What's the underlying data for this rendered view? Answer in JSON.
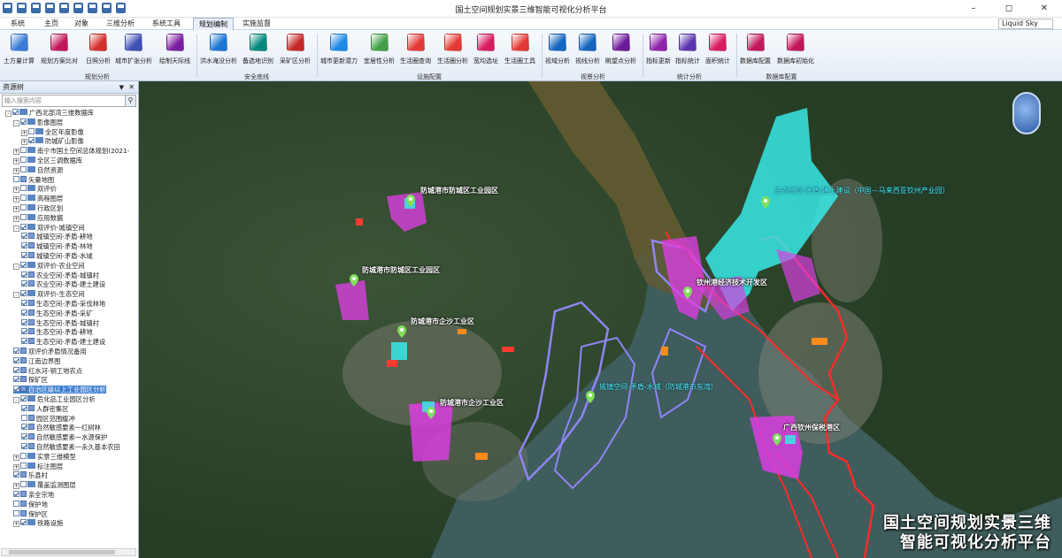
{
  "window": {
    "title": "国土空间规划实景三维智能可视化分析平台",
    "controls": [
      "–",
      "◻",
      "✕"
    ]
  },
  "tabs": [
    {
      "label": "系统"
    },
    {
      "label": "主页"
    },
    {
      "label": "对象"
    },
    {
      "label": "三维分析"
    },
    {
      "label": "系统工具"
    },
    {
      "label": "规划编制",
      "active": true
    },
    {
      "label": "实施监督"
    }
  ],
  "skin": {
    "value": "Liquid Sky"
  },
  "ribbon": {
    "buttons": [
      {
        "label": "土方量计算",
        "color": "#3a7bd5"
      },
      {
        "label": "规划方案比对",
        "color": "#c2185b"
      },
      {
        "label": "日照分析",
        "color": "#d32f2f"
      },
      {
        "label": "城市扩张分析",
        "color": "#3f51b5"
      },
      {
        "label": "绘制天际线",
        "color": "#7b1fa2"
      },
      {
        "label": "洪水淹没分析",
        "color": "#1976d2"
      },
      {
        "label": "备选地识别",
        "color": "#00897b"
      },
      {
        "label": "采矿区分析",
        "color": "#c62828"
      },
      {
        "label": "城市更新潜力",
        "color": "#1e88e5"
      },
      {
        "label": "宜居性分析",
        "color": "#43a047"
      },
      {
        "label": "生活圈查询",
        "color": "#e53935"
      },
      {
        "label": "生活圈分析",
        "color": "#e53935"
      },
      {
        "label": "宽均选址",
        "color": "#d81b60"
      },
      {
        "label": "生活圈工具",
        "color": "#e53935"
      },
      {
        "label": "视域分析",
        "color": "#1565c0"
      },
      {
        "label": "视线分析",
        "color": "#1565c0"
      },
      {
        "label": "眺望点分析",
        "color": "#6a1b9a"
      },
      {
        "label": "指标更新",
        "color": "#8e24aa"
      },
      {
        "label": "指标统计",
        "color": "#5e35b1"
      },
      {
        "label": "面积统计",
        "color": "#d81b60"
      },
      {
        "label": "数据库配置",
        "color": "#c2185b"
      },
      {
        "label": "数据库初始化",
        "color": "#c2185b"
      }
    ],
    "groups": [
      {
        "label": "规划分析"
      },
      {
        "label": "安全底线"
      },
      {
        "label": "设施配置"
      },
      {
        "label": "视景分析"
      },
      {
        "label": "统计分析"
      },
      {
        "label": "数据库配置"
      }
    ]
  },
  "left_panel": {
    "title": "资源树",
    "search_placeholder": "输入搜索内容",
    "tree": [
      {
        "label": "广西北部湾三维数据库",
        "level": 0,
        "type": "folder",
        "checked": true,
        "exp": "-"
      },
      {
        "label": "影像图层",
        "level": 1,
        "type": "folder",
        "checked": true,
        "exp": "-"
      },
      {
        "label": "全区年度影像",
        "level": 2,
        "type": "folder",
        "checked": false,
        "exp": "+"
      },
      {
        "label": "防城矿山影像",
        "level": 2,
        "type": "folder",
        "checked": true,
        "exp": "+"
      },
      {
        "label": "南宁市国土空间总体规划(2021-",
        "level": 1,
        "type": "folder",
        "checked": false,
        "exp": "+"
      },
      {
        "label": "全区三调数据库",
        "level": 1,
        "type": "folder",
        "checked": false,
        "exp": "+"
      },
      {
        "label": "自然资源",
        "level": 1,
        "type": "folder",
        "checked": false,
        "exp": "+"
      },
      {
        "label": "矢量地图",
        "level": 1,
        "type": "layer",
        "checked": false,
        "exp": ""
      },
      {
        "label": "双评价",
        "level": 1,
        "type": "folder",
        "checked": false,
        "exp": "+"
      },
      {
        "label": "高程图层",
        "level": 1,
        "type": "folder",
        "checked": false,
        "exp": "+"
      },
      {
        "label": "行政区划",
        "level": 1,
        "type": "folder",
        "checked": false,
        "exp": "+"
      },
      {
        "label": "应用数据",
        "level": 1,
        "type": "folder",
        "checked": false,
        "exp": "+"
      },
      {
        "label": "双评价-城镇空间",
        "level": 1,
        "type": "folder",
        "checked": true,
        "exp": "-"
      },
      {
        "label": "城镇空间-矛盾-耕地",
        "level": 2,
        "type": "layer",
        "checked": true,
        "exp": ""
      },
      {
        "label": "城镇空间-矛盾-林地",
        "level": 2,
        "type": "layer",
        "checked": true,
        "exp": ""
      },
      {
        "label": "城镇空间-矛盾-水域",
        "level": 2,
        "type": "layer",
        "checked": true,
        "exp": ""
      },
      {
        "label": "双评价-农业空间",
        "level": 1,
        "type": "folder",
        "checked": true,
        "exp": "-"
      },
      {
        "label": "农业空间-矛盾-城镇村",
        "level": 2,
        "type": "layer",
        "checked": true,
        "exp": ""
      },
      {
        "label": "农业空间-矛盾-建土建设",
        "level": 2,
        "type": "layer",
        "checked": true,
        "exp": ""
      },
      {
        "label": "双评价-生态空间",
        "level": 1,
        "type": "folder",
        "checked": true,
        "exp": "-"
      },
      {
        "label": "生态空间-矛盾-采伐林地",
        "level": 2,
        "type": "layer",
        "checked": true,
        "exp": ""
      },
      {
        "label": "生态空间-矛盾-采矿",
        "level": 2,
        "type": "layer",
        "checked": true,
        "exp": ""
      },
      {
        "label": "生态空间-矛盾-城镇村",
        "level": 2,
        "type": "layer",
        "checked": true,
        "exp": ""
      },
      {
        "label": "生态空间-矛盾-耕地",
        "level": 2,
        "type": "layer",
        "checked": true,
        "exp": ""
      },
      {
        "label": "生态空间-矛盾-建土建设",
        "level": 2,
        "type": "layer",
        "checked": true,
        "exp": ""
      },
      {
        "label": "双评价矛盾情况备用",
        "level": 1,
        "type": "layer",
        "checked": true,
        "exp": ""
      },
      {
        "label": "江南边界图",
        "level": 1,
        "type": "layer",
        "checked": true,
        "exp": ""
      },
      {
        "label": "红水河-铜工地农点",
        "level": 1,
        "type": "layer",
        "checked": true,
        "exp": ""
      },
      {
        "label": "探矿区",
        "level": 1,
        "type": "layer",
        "checked": true,
        "exp": ""
      },
      {
        "label": "自治区级以上工业园区分析",
        "level": 1,
        "type": "layer",
        "checked": true,
        "exp": "",
        "selected": true
      },
      {
        "label": "危化品工业园区分析",
        "level": 1,
        "type": "folder",
        "checked": true,
        "exp": "-"
      },
      {
        "label": "人群密集区",
        "level": 2,
        "type": "layer",
        "checked": true,
        "exp": ""
      },
      {
        "label": "园区范围缓冲",
        "level": 2,
        "type": "layer",
        "checked": false,
        "exp": ""
      },
      {
        "label": "自然敏感要素一红树林",
        "level": 2,
        "type": "layer",
        "checked": true,
        "exp": ""
      },
      {
        "label": "自然敏感要素一水源保护",
        "level": 2,
        "type": "layer",
        "checked": true,
        "exp": ""
      },
      {
        "label": "自然敏感要素一永久基本农田",
        "level": 2,
        "type": "layer",
        "checked": true,
        "exp": ""
      },
      {
        "label": "实景三维模型",
        "level": 1,
        "type": "folder",
        "checked": false,
        "exp": "+"
      },
      {
        "label": "标注图层",
        "level": 1,
        "type": "folder",
        "checked": false,
        "exp": "+"
      },
      {
        "label": "乐县村",
        "level": 1,
        "type": "layer",
        "checked": true,
        "exp": ""
      },
      {
        "label": "覆盖监测图层",
        "level": 1,
        "type": "folder",
        "checked": false,
        "exp": "+"
      },
      {
        "label": "亲全宗地",
        "level": 1,
        "type": "layer",
        "checked": true,
        "exp": ""
      },
      {
        "label": "保护地",
        "level": 1,
        "type": "layer",
        "checked": false,
        "exp": ""
      },
      {
        "label": "保护区",
        "level": 1,
        "type": "layer",
        "checked": false,
        "exp": ""
      },
      {
        "label": "铁路设施",
        "level": 1,
        "type": "folder",
        "checked": true,
        "exp": "+"
      }
    ]
  },
  "map": {
    "labels": [
      {
        "text": "防城港市防城区工业园区",
        "style": "white"
      },
      {
        "text": "防城港市防城区工业园区",
        "style": "white"
      },
      {
        "text": "防城港市企沙工业区",
        "style": "white"
      },
      {
        "text": "防城港市企沙工业区",
        "style": "white"
      },
      {
        "text": "生态空间-矛盾-建土建设（中国—马来西亚钦州产业园）",
        "style": "cyan"
      },
      {
        "text": "钦州港经济技术开发区",
        "style": "white"
      },
      {
        "text": "城镇空间-矛盾-水域（防城港市东湾）",
        "style": "cyan"
      },
      {
        "text": "广西钦州保税港区",
        "style": "white"
      }
    ],
    "brand_line1": "国土空间规划实景三维",
    "brand_line2": "智能可视化分析平台",
    "colors": {
      "land": "#2f4a2c",
      "sea": "#3d5a5b",
      "river": "#5f5a2f",
      "conflict_magenta": "#d93ee0",
      "conflict_cyan": "#37e9e6",
      "water_outline": "#8f85f5",
      "boundary_red": "#ff2a2a",
      "pin": "#7fe05a"
    }
  }
}
